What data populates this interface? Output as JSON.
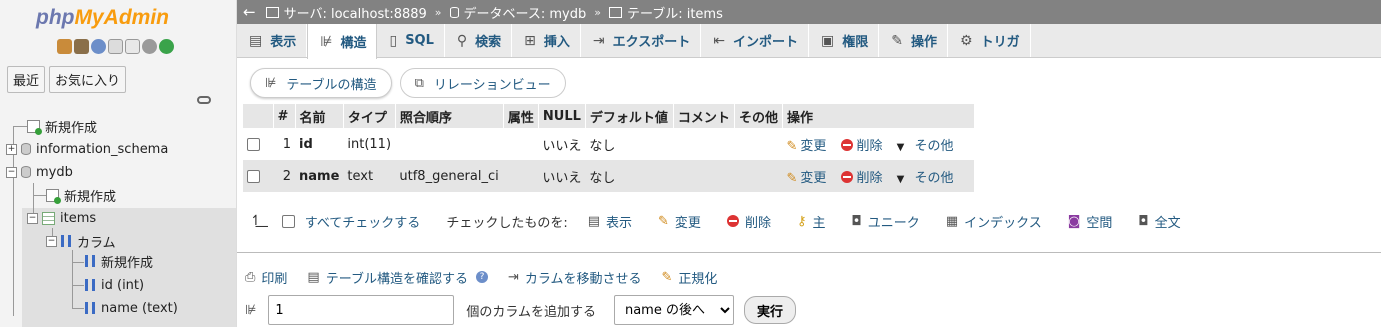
{
  "app": {
    "logo_php": "php",
    "logo_myadmin": "MyAdmin"
  },
  "nav": {
    "tabs": [
      {
        "label": "最近"
      },
      {
        "label": "お気に入り"
      }
    ],
    "tree": {
      "new": "新規作成",
      "information_schema": "information_schema",
      "mydb": "mydb",
      "mydb_new": "新規作成",
      "items": "items",
      "columns": "カラム",
      "columns_new": "新規作成",
      "col_id": "id (int)",
      "col_name": "name (text)"
    }
  },
  "breadcrumb": {
    "server": "サーバ: localhost:8889",
    "database": "データベース: mydb",
    "table": "テーブル: items",
    "separator": "»"
  },
  "tabs": [
    {
      "label": "表示",
      "icon": "browse-icon"
    },
    {
      "label": "構造",
      "icon": "structure-icon",
      "active": true
    },
    {
      "label": "SQL",
      "icon": "sql-icon"
    },
    {
      "label": "検索",
      "icon": "search-icon"
    },
    {
      "label": "挿入",
      "icon": "insert-icon"
    },
    {
      "label": "エクスポート",
      "icon": "export-icon"
    },
    {
      "label": "インポート",
      "icon": "import-icon"
    },
    {
      "label": "権限",
      "icon": "privileges-icon"
    },
    {
      "label": "操作",
      "icon": "wrench-icon"
    },
    {
      "label": "トリガ",
      "icon": "triggers-icon"
    }
  ],
  "subtabs": [
    {
      "label": "テーブルの構造",
      "active": true
    },
    {
      "label": "リレーションビュー"
    }
  ],
  "structure_table": {
    "headers": [
      "",
      "#",
      "名前",
      "タイプ",
      "照合順序",
      "属性",
      "NULL",
      "デフォルト値",
      "コメント",
      "その他",
      "操作"
    ],
    "rows": [
      {
        "num": "1",
        "name": "id",
        "type": "int(11)",
        "collation": "",
        "attributes": "",
        "null": "いいえ",
        "default": "なし",
        "comment": "",
        "extra": ""
      },
      {
        "num": "2",
        "name": "name",
        "type": "text",
        "collation": "utf8_general_ci",
        "attributes": "",
        "null": "いいえ",
        "default": "なし",
        "comment": "",
        "extra": ""
      }
    ],
    "actions": {
      "edit": "変更",
      "delete": "削除",
      "more": "その他"
    }
  },
  "bulk": {
    "check_all": "すべてチェックする",
    "with_selected": "チェックしたものを:",
    "actions": [
      {
        "label": "表示",
        "icon": "browse-icon"
      },
      {
        "label": "変更",
        "icon": "pencil-icon"
      },
      {
        "label": "削除",
        "icon": "delete-icon"
      },
      {
        "label": "主",
        "icon": "primary-key-icon"
      },
      {
        "label": "ユニーク",
        "icon": "unique-icon"
      },
      {
        "label": "インデックス",
        "icon": "index-icon"
      },
      {
        "label": "空間",
        "icon": "spatial-icon"
      },
      {
        "label": "全文",
        "icon": "fulltext-icon"
      }
    ]
  },
  "bottom_links": {
    "print": "印刷",
    "propose": "テーブル構造を確認する",
    "move_columns": "カラムを移動させる",
    "normalize": "正規化"
  },
  "add_column": {
    "count": "1",
    "label": "個のカラムを追加する",
    "position": "name の後へ",
    "go": "実行"
  }
}
